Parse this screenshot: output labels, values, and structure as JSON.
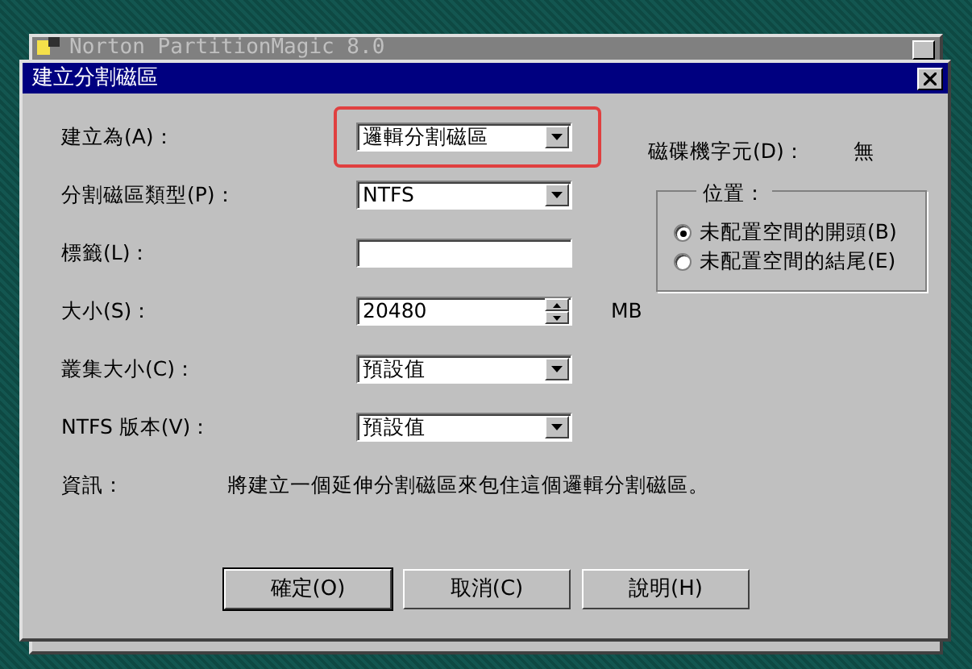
{
  "background_window": {
    "title": "Norton PartitionMagic 8.0"
  },
  "dialog": {
    "title": "建立分割磁區",
    "fields": [
      {
        "label": "建立為(A)：",
        "kind": "dropdown",
        "value": "邏輯分割磁區",
        "highlighted": true
      },
      {
        "label": "分割磁區類型(P)：",
        "kind": "dropdown",
        "value": "NTFS",
        "highlighted": false
      },
      {
        "label": "標籤(L)：",
        "kind": "text",
        "highlighted": false
      },
      {
        "label": "大小(S)：",
        "kind": "spinner",
        "value": "20480",
        "unit": "MB",
        "highlighted": false
      },
      {
        "label": "叢集大小(C)：",
        "kind": "dropdown",
        "value": "預設值",
        "highlighted": false
      },
      {
        "label": "NTFS 版本(V)：",
        "kind": "dropdown",
        "value": "預設值",
        "highlighted": false
      }
    ],
    "drive_letter": {
      "label": "磁碟機字元(D)：",
      "value": "無"
    },
    "position": {
      "title": "位置：",
      "options": [
        {
          "label": "未配置空間的開頭(B)",
          "selected": true
        },
        {
          "label": "未配置空間的結尾(E)",
          "selected": false
        }
      ]
    },
    "info": {
      "label": "資訊：",
      "text": "將建立一個延伸分割磁區來包住這個邏輯分割磁區。"
    },
    "buttons": [
      {
        "label": "確定(O)",
        "default": true
      },
      {
        "label": "取消(C)",
        "default": false
      },
      {
        "label": "說明(H)",
        "default": false
      }
    ]
  }
}
